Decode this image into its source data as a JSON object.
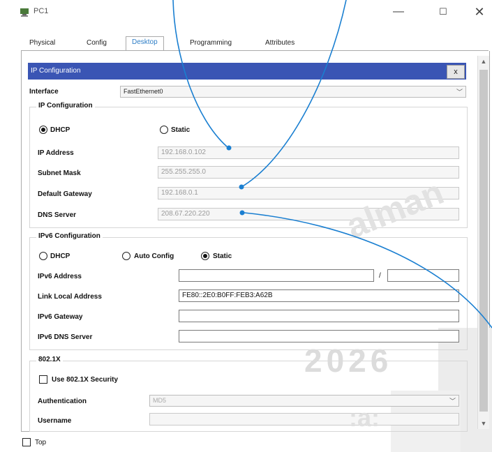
{
  "window": {
    "title": "PC1",
    "minimize": "—",
    "maximize": "☐",
    "close": "✕"
  },
  "tabs": [
    {
      "label": "Physical"
    },
    {
      "label": "Config"
    },
    {
      "label": "Desktop"
    },
    {
      "label": "Programming"
    },
    {
      "label": "Attributes"
    }
  ],
  "dialog": {
    "title": "IP Configuration",
    "close": "x"
  },
  "interface": {
    "label": "Interface",
    "value": "FastEthernet0"
  },
  "ipv4": {
    "group_label": "IP Configuration",
    "dhcp_label": "DHCP",
    "static_label": "Static",
    "ip_label": "IP Address",
    "ip_value": "192.168.0.102",
    "mask_label": "Subnet Mask",
    "mask_value": "255.255.255.0",
    "gateway_label": "Default Gateway",
    "gateway_value": "192.168.0.1",
    "dns_label": "DNS Server",
    "dns_value": "208.67.220.220"
  },
  "ipv6": {
    "group_label": "IPv6 Configuration",
    "dhcp_label": "DHCP",
    "auto_label": "Auto Config",
    "static_label": "Static",
    "addr_label": "IPv6 Address",
    "addr_value": "",
    "prefix_sep": "/",
    "prefix_value": "",
    "link_label": "Link Local Address",
    "link_value": "FE80::2E0:B0FF:FEB3:A62B",
    "gw_label": "IPv6 Gateway",
    "gw_value": "",
    "dns_label": "IPv6 DNS Server",
    "dns_value": ""
  },
  "dot1x": {
    "group_label": "802.1X",
    "use_label": "Use 802.1X Security",
    "auth_label": "Authentication",
    "auth_value": "MD5",
    "user_label": "Username",
    "user_value": ""
  },
  "footer": {
    "top_label": "Top"
  },
  "watermark": {
    "text1": "alman",
    "text2": "2026",
    "text3": ":a:"
  },
  "colors": {
    "title_bar": "#3a55b4",
    "active_tab": "#2e7ec6",
    "annotation": "#1a7fd1"
  }
}
